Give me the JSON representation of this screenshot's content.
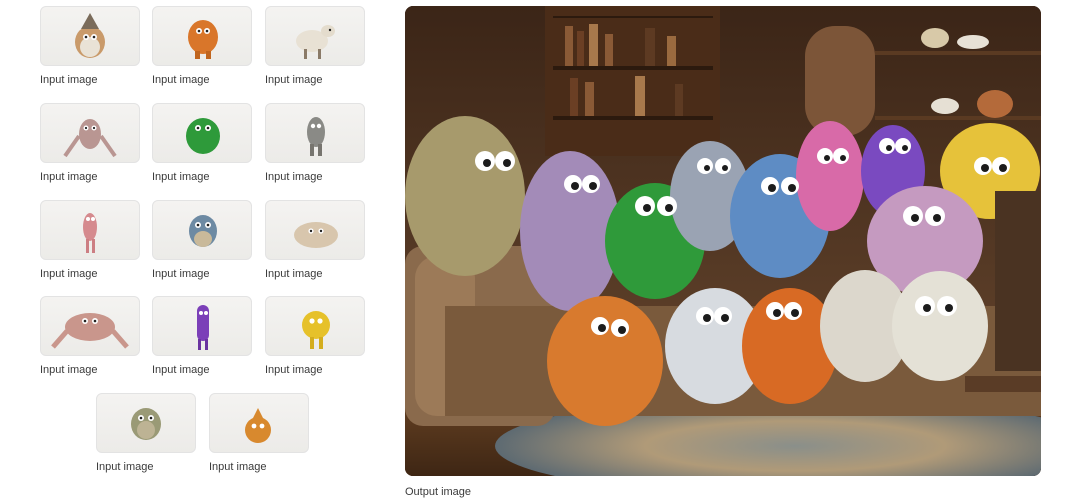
{
  "inputs": [
    {
      "label": "Input image",
      "figure": "wizard-hat-monster"
    },
    {
      "label": "Input image",
      "figure": "orange-fluffy-monster"
    },
    {
      "label": "Input image",
      "figure": "sheep"
    },
    {
      "label": "Input image",
      "figure": "pink-long-arm-monster"
    },
    {
      "label": "Input image",
      "figure": "green-monster"
    },
    {
      "label": "Input image",
      "figure": "gray-shaggy-monster"
    },
    {
      "label": "Input image",
      "figure": "pink-thin-monster"
    },
    {
      "label": "Input image",
      "figure": "blue-furry-monster"
    },
    {
      "label": "Input image",
      "figure": "beige-puffball-monster"
    },
    {
      "label": "Input image",
      "figure": "pink-wide-monster"
    },
    {
      "label": "Input image",
      "figure": "purple-tall-monster"
    },
    {
      "label": "Input image",
      "figure": "yellow-fluffy-monster"
    },
    {
      "label": "Input image",
      "figure": "mossy-green-monster"
    },
    {
      "label": "Input image",
      "figure": "orange-spiky-monster"
    }
  ],
  "output": {
    "label": "Output image",
    "figure": "group-of-monsters-on-sofa"
  },
  "colors": {
    "thumb_border": "#e3e3e3",
    "label_text": "#3a3a3a"
  }
}
